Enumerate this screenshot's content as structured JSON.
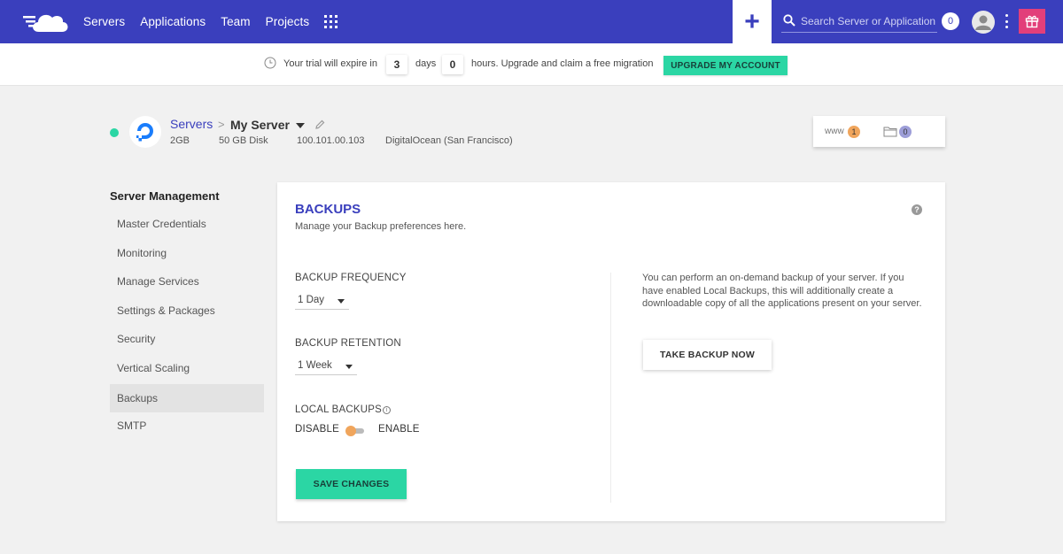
{
  "colors": {
    "brand": "#3a3fbd",
    "accent_green": "#2bd6a4",
    "status_online": "#2bd6a4",
    "badge_orange": "#f0a55c",
    "badge_purple": "#9d9ed8",
    "gift": "#e23f7a"
  },
  "topnav": {
    "logo_icon": "cloud-logo-icon",
    "links": [
      "Servers",
      "Applications",
      "Team",
      "Projects"
    ],
    "apps_icon": "grid-icon",
    "plus_label": "+",
    "search_placeholder": "Search Server or Application",
    "notification_count": "0",
    "avatar_icon": "user-avatar-icon",
    "menu_icon": "kebab-icon",
    "gift_icon": "gift-icon"
  },
  "trial": {
    "prefix": "Your trial will expire in",
    "days_value": "3",
    "days_label": "days",
    "hours_value": "0",
    "hours_label": "hours. Upgrade and claim a free migration",
    "upgrade_label": "UPGRADE MY ACCOUNT"
  },
  "server": {
    "breadcrumb_root": "Servers",
    "breadcrumb_sep": ">",
    "name": "My Server",
    "ram": "2GB",
    "disk": "50 GB Disk",
    "ip": "100.101.00.103",
    "provider": "DigitalOcean (San Francisco)",
    "status": "online",
    "www_label": "www",
    "apps_count": "1",
    "files_count": "0"
  },
  "sidebar": {
    "title": "Server Management",
    "items": [
      {
        "label": "Master Credentials",
        "active": false
      },
      {
        "label": "Monitoring",
        "active": false
      },
      {
        "label": "Manage Services",
        "active": false
      },
      {
        "label": "Settings & Packages",
        "active": false
      },
      {
        "label": "Security",
        "active": false
      },
      {
        "label": "Vertical Scaling",
        "active": false
      },
      {
        "label": "Backups",
        "active": true
      },
      {
        "label": "SMTP",
        "active": false
      }
    ]
  },
  "backups": {
    "title": "BACKUPS",
    "subtitle": "Manage your Backup preferences here.",
    "help_label": "?",
    "frequency_label": "BACKUP FREQUENCY",
    "frequency_value": "1 Day",
    "retention_label": "BACKUP RETENTION",
    "retention_value": "1 Week",
    "local_label": "LOCAL BACKUPS",
    "info_label": "i",
    "disable_label": "DISABLE",
    "enable_label": "ENABLE",
    "local_enabled": false,
    "save_label": "SAVE CHANGES",
    "description": "You can perform an on-demand backup of your server. If you have enabled Local Backups, this will additionally create a downloadable copy of all the applications present on your server.",
    "take_backup_label": "TAKE BACKUP NOW"
  }
}
